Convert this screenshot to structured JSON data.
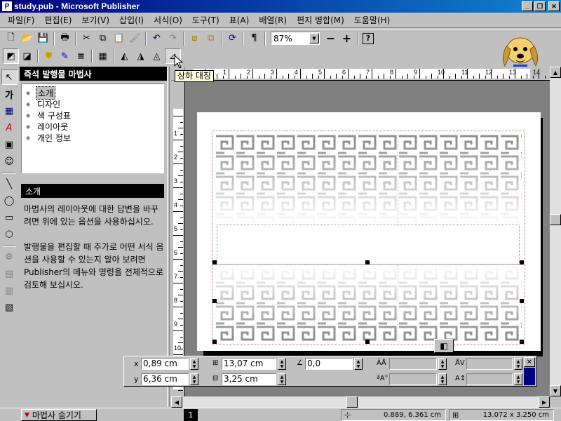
{
  "window": {
    "title": "study.pub - Microsoft Publisher",
    "icon": "publisher-icon",
    "buttons": [
      "minimize",
      "maximize",
      "close"
    ]
  },
  "menu": [
    {
      "name": "menu-file",
      "label": "파일(F)"
    },
    {
      "name": "menu-edit",
      "label": "편집(E)"
    },
    {
      "name": "menu-view",
      "label": "보기(V)"
    },
    {
      "name": "menu-insert",
      "label": "삽입(I)"
    },
    {
      "name": "menu-format",
      "label": "서식(O)"
    },
    {
      "name": "menu-tools",
      "label": "도구(T)"
    },
    {
      "name": "menu-table",
      "label": "표(A)"
    },
    {
      "name": "menu-arrange",
      "label": "배열(R)"
    },
    {
      "name": "menu-mail-merge",
      "label": "편지 병합(M)"
    },
    {
      "name": "menu-help",
      "label": "도움말(H)"
    }
  ],
  "toolbar": {
    "zoom": "87%",
    "zoom_out_label": "−",
    "zoom_in_label": "+",
    "paragraph_label": "¶"
  },
  "tooltip": "상하 대칭",
  "wizard": {
    "header": "즉석 발행물 마법사",
    "items": [
      "소개",
      "디자인",
      "색 구성표",
      "레이아웃",
      "개인 정보"
    ],
    "selected": "소개",
    "desc_title": "소개",
    "desc_para1": "마법사의 레이아웃에 대한 답변을 바꾸려면 위에 있는 옵션을 사용하십시오.",
    "desc_para2": "발행물을 편집할 때 추가로 어떤 서식 옵션을 사용할 수 있는지 알아 보려면 Publisher의 메뉴와 명령을 전체적으로 검토해 보십시오."
  },
  "ruler": {
    "h_numbers": [
      "1",
      "2",
      "3",
      "4",
      "5",
      "6",
      "7",
      "8",
      "9",
      "10",
      "11",
      "12",
      "13",
      "14"
    ],
    "v_numbers": [
      "1",
      "2",
      "3",
      "4",
      "5",
      "6",
      "7",
      "8",
      "9",
      "10"
    ]
  },
  "measurements": {
    "x_label": "x",
    "y_label": "y",
    "x_value": "0,89 cm",
    "y_value": "6,36 cm",
    "width_value": "13,07 cm",
    "height_value": "3,25 cm",
    "angle_value": "0,0"
  },
  "status": {
    "wizard_toggle": "마법사 숨기기",
    "page": "1",
    "position": "0.889, 6.361 cm",
    "size": "13.072 x 3.250 cm"
  },
  "colors": {
    "title_bar": "#000080",
    "tooltip_bg": "#ffffe1",
    "guide": "#c07070"
  }
}
